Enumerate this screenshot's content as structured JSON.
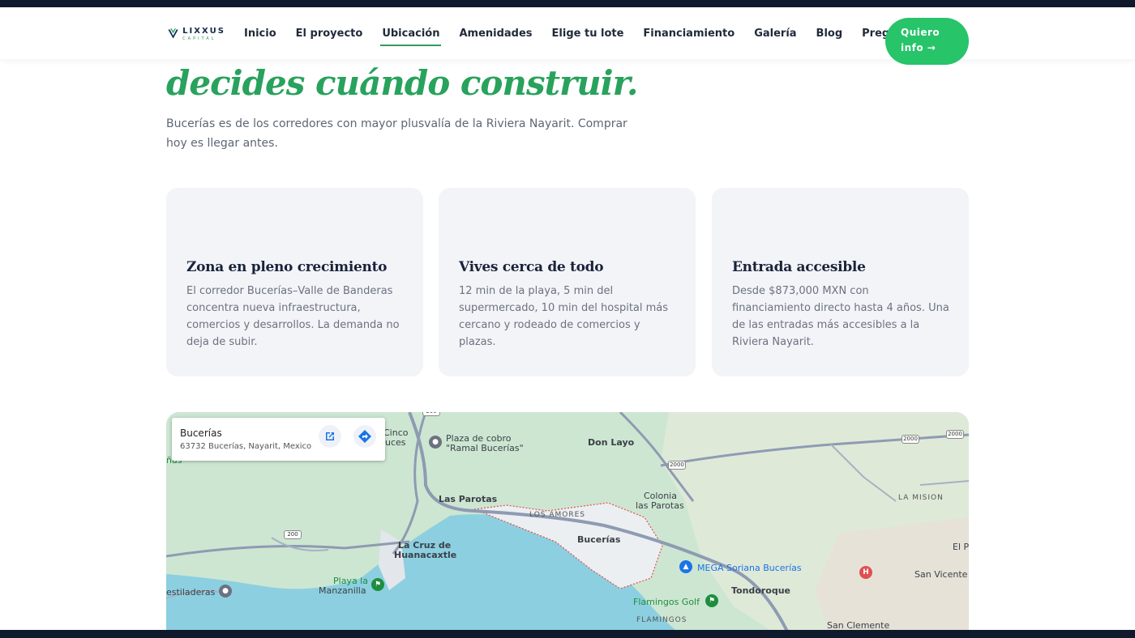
{
  "nav": {
    "logo": {
      "name": "LIXXUS",
      "sub": "CAPITAL"
    },
    "links": [
      "Inicio",
      "El proyecto",
      "Ubicación",
      "Amenidades",
      "Elige tu lote",
      "Financiamiento",
      "Galería",
      "Blog",
      "Preguntas"
    ],
    "active": "Ubicación",
    "cta_line1": "Quiero",
    "cta_line2": "info →"
  },
  "hero": {
    "title": "decides cuándo construir.",
    "subtitle": "Bucerías es de los corredores con mayor plusvalía de la Riviera Nayarit. Comprar hoy es llegar antes."
  },
  "cards": [
    {
      "title": "Zona en pleno crecimiento",
      "text": "El corredor Bucerías–Valle de Banderas concentra nueva infraestructura, comercios y desarrollos. La demanda no deja de subir."
    },
    {
      "title": "Vives cerca de todo",
      "text": "12 min de la playa, 5 min del supermercado, 10 min del hospital más cercano y rodeado de comercios y plazas."
    },
    {
      "title": "Entrada accesible",
      "text": "Desde $873,000 MXN con financiamiento directo hasta 4 años. Una de las entradas más accesibles a la Riviera Nayarit."
    }
  ],
  "map": {
    "place_title": "Bucerías",
    "place_address": "63732 Bucerías, Nayarit, Mexico",
    "labels": {
      "cinco": "Cinco",
      "luces": "uces",
      "plaza1": "Plaza de cobro",
      "plaza2": "\"Ramal Bucerías\"",
      "don_layo": "Don Layo",
      "colonia1": "Colonia",
      "colonia2": "las Parotas",
      "la_mision": "LA MISION",
      "las_parotas": "Las Parotas",
      "los_amores": "LOS AMORES",
      "bucerias": "Bucerías",
      "la_cruz1": "La Cruz de",
      "la_cruz2": "Huanacaxtle",
      "mega": "MEGA Soriana Bucerías",
      "el_p": "El P",
      "san_vicente": "San Vicente",
      "playa1": "Playa la",
      "playa2": "Manzanilla",
      "estiladeras": "estiladeras",
      "tondoroque": "Tondoroque",
      "flamingos_golf": "Flamingos Golf",
      "flamingos": "FLAMINGOS",
      "san_clemente": "San Clemente",
      "left_edge": "ñas",
      "hwy200": "200",
      "hwy2000": "2000"
    }
  },
  "colors": {
    "accent": "#28a25c",
    "cta": "#27c46a",
    "dark": "#0f1b2d",
    "card_bg": "#f3f4f8"
  },
  "icons": [
    "lixxus-logo-icon",
    "open-in-new-icon",
    "directions-icon",
    "place-pin-icon",
    "hospital-icon",
    "shopping-icon",
    "golf-icon",
    "beach-icon"
  ]
}
